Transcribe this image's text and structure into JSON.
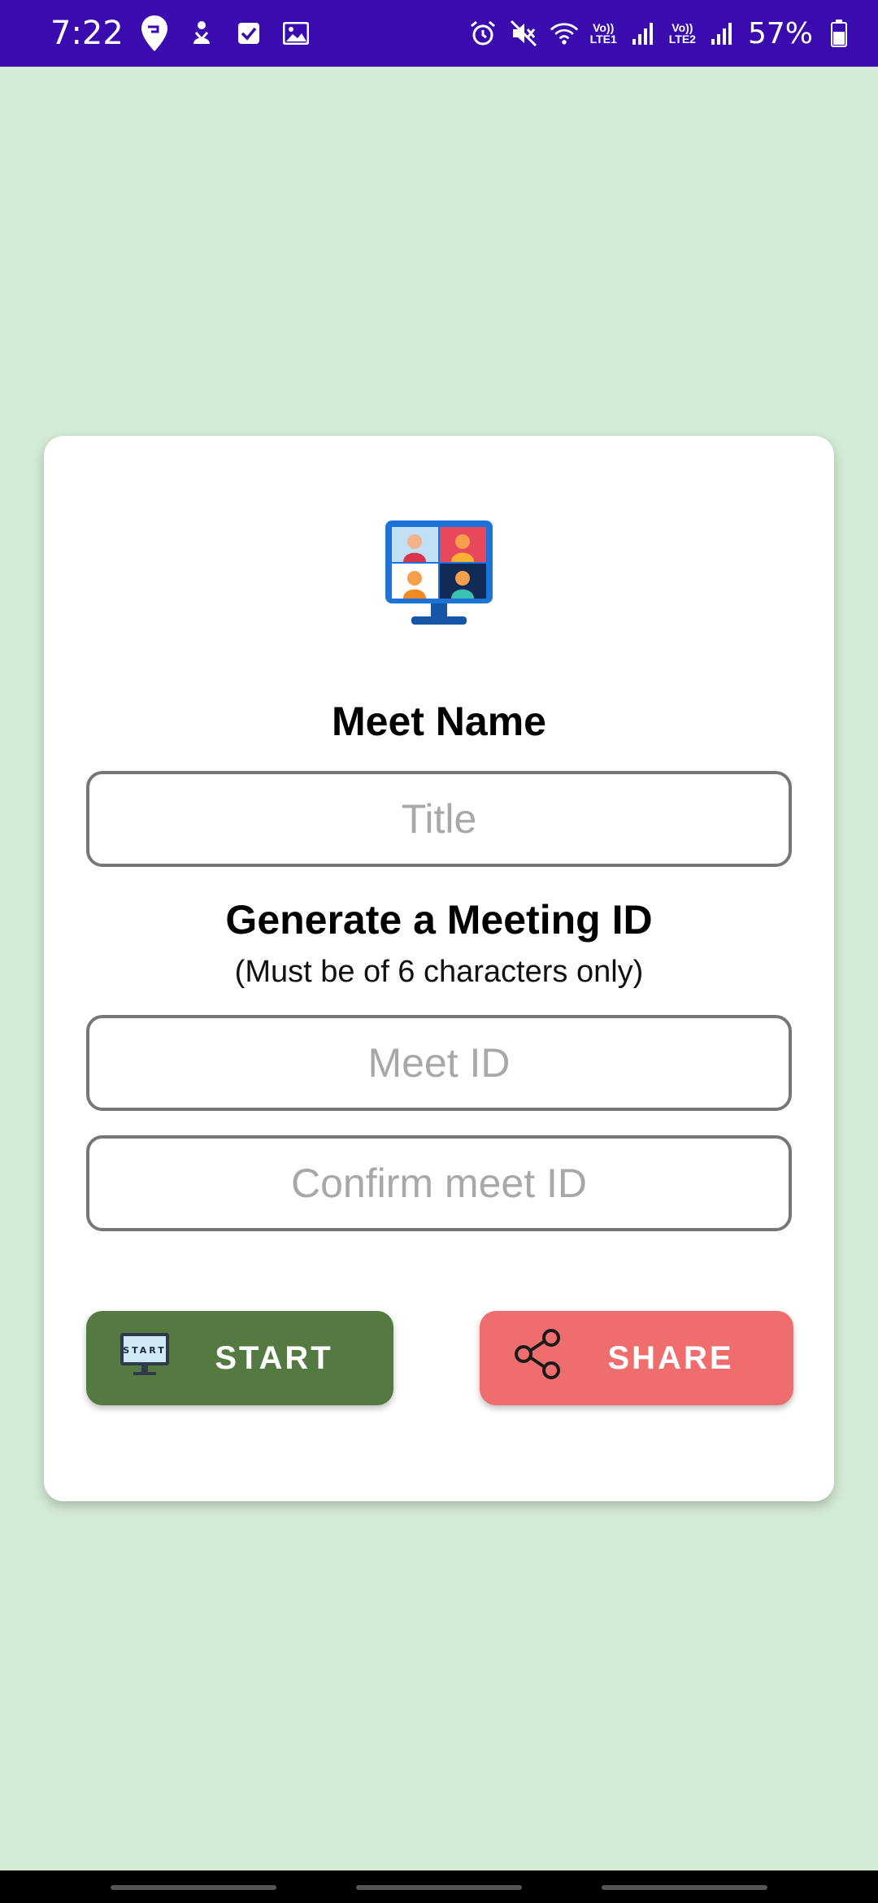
{
  "status_bar": {
    "time": "7:22",
    "battery": "57%",
    "sim1_top": "Vo))",
    "sim1_bottom": "LTE1",
    "sim2_top": "Vo))",
    "sim2_bottom": "LTE2",
    "icons_left": [
      "swiggy-icon",
      "download-person-icon",
      "checkbox-icon",
      "image-icon"
    ],
    "icons_right": [
      "alarm-icon",
      "mute-icon",
      "wifi-icon",
      "signal-icon",
      "battery-icon"
    ]
  },
  "card": {
    "hero_icon": "video-conference-icon",
    "meet_name_label": "Meet Name",
    "title_placeholder": "Title",
    "generate_heading": "Generate a Meeting ID",
    "generate_sub": "(Must be of 6 characters only)",
    "meet_id_placeholder": "Meet ID",
    "confirm_placeholder": "Confirm meet ID",
    "start_button": "START",
    "share_button": "SHARE"
  },
  "colors": {
    "status_bar": "#3a0cb0",
    "background": "#d4ebd6",
    "start": "#547a42",
    "share": "#f06d6d"
  }
}
